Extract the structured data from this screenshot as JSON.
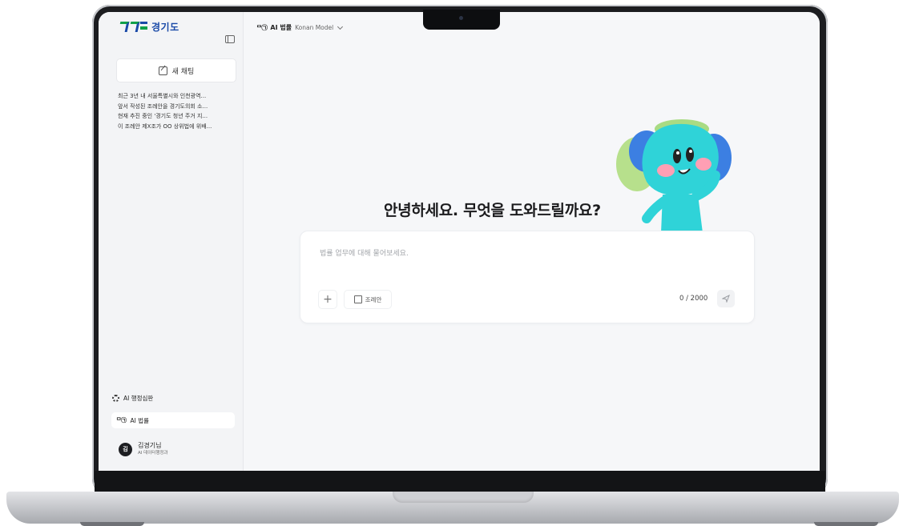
{
  "sidebar": {
    "logo_text": "경기도",
    "new_chat_label": "새 채팅",
    "history": [
      "최근 3년 내 서울특별시와 인천광역...",
      "앞서 작성된 조례안을 경기도의회 소...",
      "현재 추진 중인 '경기도 청년 주거 지...",
      "이 조례안 제X조가 OO 상위법에 위배..."
    ],
    "menu": [
      {
        "label": "AI 행정심판",
        "icon": "gear-icon"
      },
      {
        "label": "AI 법률",
        "icon": "law-icon",
        "active": true
      }
    ],
    "user": {
      "initial": "김",
      "name": "김경기님",
      "dept": "AI 데이터행정과"
    }
  },
  "topbar": {
    "icon_text": "ᄆ",
    "title": "AI 법률",
    "model": "Konan Model"
  },
  "main": {
    "greeting": "안녕하세요. 무엇을 도와드릴까요?",
    "input_placeholder": "법률 업무에 대해 물어보세요.",
    "plus_label": "+",
    "ordinance_label": "조례안",
    "counter": "0 / 2000"
  },
  "colors": {
    "brand_blue": "#1a4aa8",
    "brand_green": "#12a04a",
    "mascot": "#2fd3d8"
  }
}
